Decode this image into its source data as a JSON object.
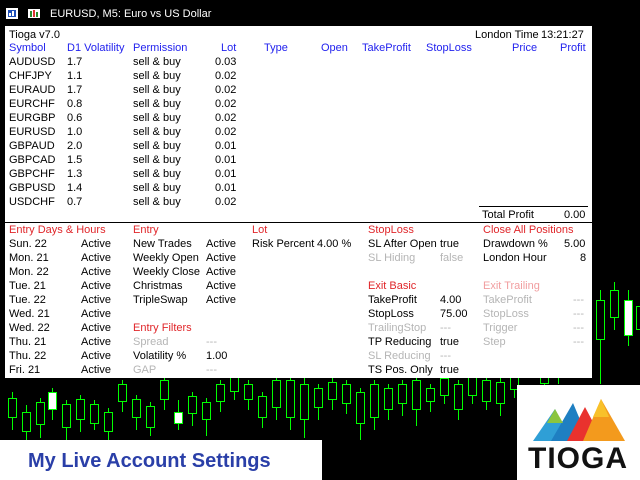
{
  "window": {
    "title": "EURUSD, M5:  Euro vs US Dollar"
  },
  "panel": {
    "name": "Tioga v7.0",
    "clock_label": "London Time",
    "clock_value": "13:21:27",
    "headers": [
      "Symbol",
      "D1 Volatility",
      "Permission",
      "Lot",
      "Type",
      "Open",
      "TakeProfit",
      "StopLoss",
      "Price",
      "Profit"
    ],
    "rows": [
      {
        "symbol": "AUDUSD",
        "vol": "1.7",
        "perm": "sell & buy",
        "lot": "0.03"
      },
      {
        "symbol": "CHFJPY",
        "vol": "1.1",
        "perm": "sell & buy",
        "lot": "0.02"
      },
      {
        "symbol": "EURAUD",
        "vol": "1.7",
        "perm": "sell & buy",
        "lot": "0.02"
      },
      {
        "symbol": "EURCHF",
        "vol": "0.8",
        "perm": "sell & buy",
        "lot": "0.02"
      },
      {
        "symbol": "EURGBP",
        "vol": "0.6",
        "perm": "sell & buy",
        "lot": "0.02"
      },
      {
        "symbol": "EURUSD",
        "vol": "1.0",
        "perm": "sell & buy",
        "lot": "0.02"
      },
      {
        "symbol": "GBPAUD",
        "vol": "2.0",
        "perm": "sell & buy",
        "lot": "0.01"
      },
      {
        "symbol": "GBPCAD",
        "vol": "1.5",
        "perm": "sell & buy",
        "lot": "0.01"
      },
      {
        "symbol": "GBPCHF",
        "vol": "1.3",
        "perm": "sell & buy",
        "lot": "0.01"
      },
      {
        "symbol": "GBPUSD",
        "vol": "1.4",
        "perm": "sell & buy",
        "lot": "0.01"
      },
      {
        "symbol": "USDCHF",
        "vol": "0.7",
        "perm": "sell & buy",
        "lot": "0.02"
      }
    ],
    "total_profit_label": "Total Profit",
    "total_profit_value": "0.00"
  },
  "settings": {
    "entry_days": {
      "title": "Entry Days & Hours",
      "rows": [
        {
          "day": "Sun. 22",
          "status": "Active"
        },
        {
          "day": "Mon. 21",
          "status": "Active"
        },
        {
          "day": "Mon. 22",
          "status": "Active"
        },
        {
          "day": "Tue. 21",
          "status": "Active"
        },
        {
          "day": "Tue. 22",
          "status": "Active"
        },
        {
          "day": "Wed. 21",
          "status": "Active"
        },
        {
          "day": "Wed. 22",
          "status": "Active"
        },
        {
          "day": "Thu. 21",
          "status": "Active"
        },
        {
          "day": "Thu. 22",
          "status": "Active"
        },
        {
          "day": "Fri. 21",
          "status": "Active"
        }
      ]
    },
    "entry": {
      "title": "Entry",
      "rows": [
        {
          "label": "New Trades",
          "value": "Active"
        },
        {
          "label": "Weekly Open",
          "value": "Active"
        },
        {
          "label": "Weekly Close",
          "value": "Active"
        },
        {
          "label": "Christmas",
          "value": "Active"
        },
        {
          "label": "TripleSwap",
          "value": "Active"
        }
      ]
    },
    "entry_filters": {
      "title": "Entry Filters",
      "rows": [
        {
          "label": "Spread",
          "value": "---"
        },
        {
          "label": "Volatility %",
          "value": "1.00"
        },
        {
          "label": "GAP",
          "value": "---"
        }
      ]
    },
    "lot": {
      "title": "Lot",
      "label": "Risk Percent",
      "value": "4.00 %"
    },
    "stoploss": {
      "title": "StopLoss",
      "rows": [
        {
          "label": "SL After Open",
          "value": "true"
        },
        {
          "label": "SL Hiding",
          "value": "false"
        }
      ]
    },
    "exit_basic": {
      "title": "Exit Basic",
      "rows": [
        {
          "label": "TakeProfit",
          "value": "4.00"
        },
        {
          "label": "StopLoss",
          "value": "75.00"
        },
        {
          "label": "TrailingStop",
          "value": "---"
        },
        {
          "label": "TP Reducing",
          "value": "true"
        },
        {
          "label": "SL Reducing",
          "value": "---"
        },
        {
          "label": "TS Pos. Only",
          "value": "true"
        }
      ]
    },
    "close_all": {
      "title": "Close All Positions",
      "rows": [
        {
          "label": "Drawdown %",
          "value": "5.00"
        },
        {
          "label": "London Hour",
          "value": "8"
        }
      ]
    },
    "exit_trailing": {
      "title": "Exit Trailing",
      "rows": [
        {
          "label": "TakeProfit",
          "value": "---"
        },
        {
          "label": "StopLoss",
          "value": "---"
        },
        {
          "label": "Trigger",
          "value": "---"
        },
        {
          "label": "Step",
          "value": "---"
        }
      ]
    }
  },
  "banner": {
    "text": "My Live Account Settings"
  },
  "logo": {
    "text": "TIOGA"
  },
  "colors": {
    "header_blue": "#2222ee",
    "section_red": "#e0262a",
    "inactive_grey": "#b5b5b5",
    "candle_green": "#00ff00",
    "banner_blue": "#2a3fa8"
  }
}
